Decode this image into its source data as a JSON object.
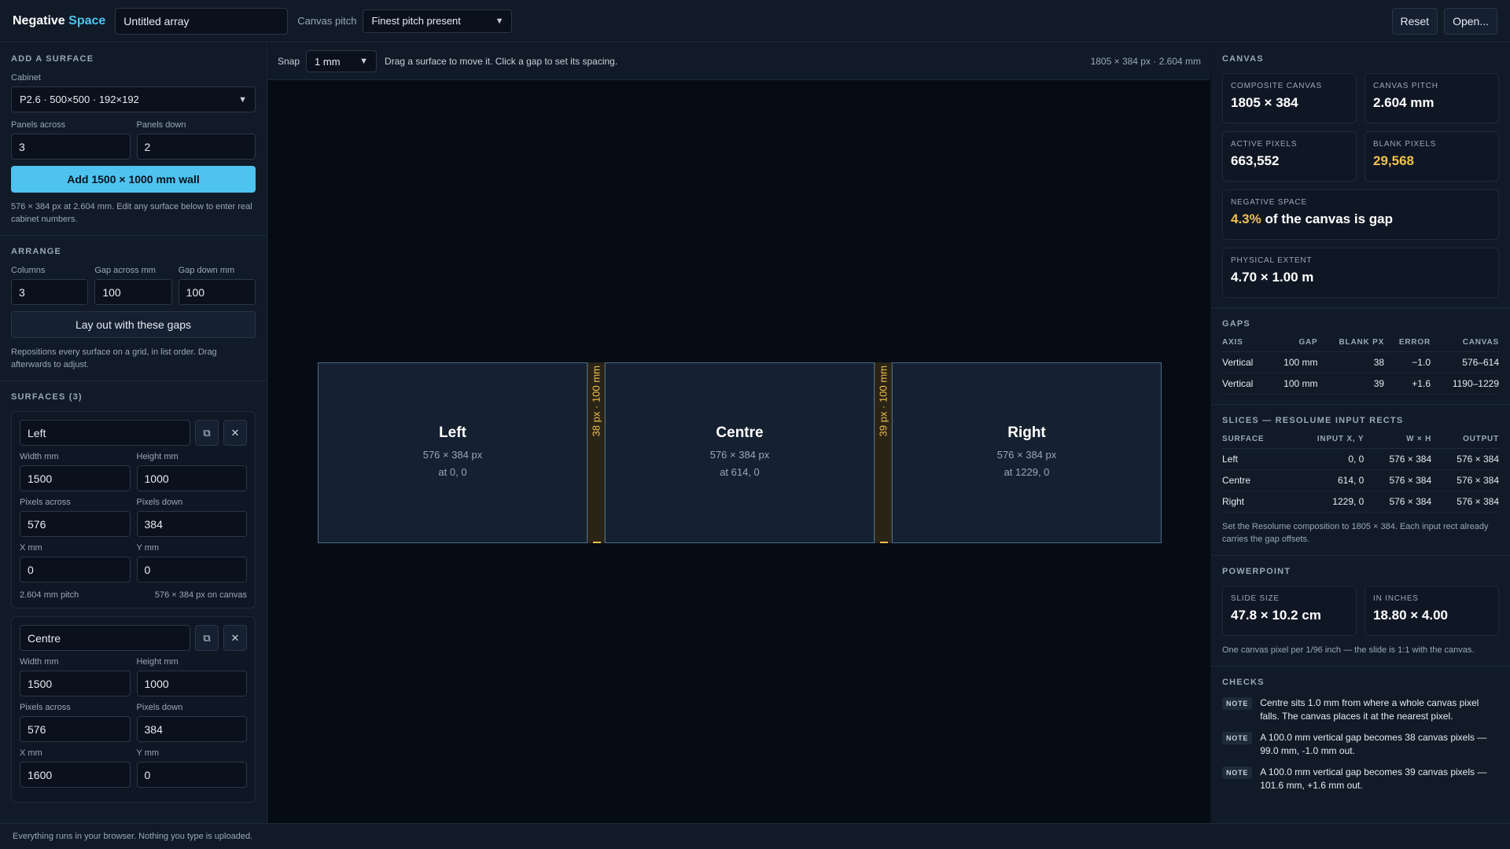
{
  "header": {
    "brand_prefix": "Negative",
    "brand_accent": "Space",
    "title_value": "Untitled array",
    "pitch_label": "Canvas pitch",
    "pitch_value": "Finest pitch present",
    "reset_label": "Reset",
    "open_label": "Open..."
  },
  "add_surface": {
    "title": "ADD A SURFACE",
    "cabinet_label": "Cabinet",
    "cabinet_value": "P2.6 · 500×500 · 192×192",
    "panels_across_label": "Panels across",
    "panels_across_value": "3",
    "panels_down_label": "Panels down",
    "panels_down_value": "2",
    "add_button": "Add 1500 × 1000 mm wall",
    "help": "576 × 384 px at 2.604 mm. Edit any surface below to enter real cabinet numbers."
  },
  "arrange": {
    "title": "ARRANGE",
    "columns_label": "Columns",
    "columns_value": "3",
    "gap_across_label": "Gap across mm",
    "gap_across_value": "100",
    "gap_down_label": "Gap down mm",
    "gap_down_value": "100",
    "layout_button": "Lay out with these gaps",
    "help": "Repositions every surface on a grid, in list order. Drag afterwards to adjust."
  },
  "surfaces_panel": {
    "title": "SURFACES (3)",
    "labels": {
      "width": "Width mm",
      "height": "Height mm",
      "px_across": "Pixels across",
      "px_down": "Pixels down",
      "x": "X mm",
      "y": "Y mm"
    },
    "cards": [
      {
        "name": "Left",
        "width": "1500",
        "height": "1000",
        "px_across": "576",
        "px_down": "384",
        "x": "0",
        "y": "0",
        "pitch_note": "2.604 mm pitch",
        "canvas_note": "576 × 384 px on canvas"
      },
      {
        "name": "Centre",
        "width": "1500",
        "height": "1000",
        "px_across": "576",
        "px_down": "384",
        "x": "1600",
        "y": "0"
      }
    ]
  },
  "toolbar": {
    "snap_label": "Snap",
    "snap_value": "1 mm",
    "hint": "Drag a surface to move it. Click a gap to set its spacing.",
    "meta": "1805 × 384 px · 2.604 mm"
  },
  "canvas": {
    "surfaces": [
      {
        "name": "Left",
        "size": "576 × 384 px",
        "position": "at 0, 0"
      },
      {
        "name": "Centre",
        "size": "576 × 384 px",
        "position": "at 614, 0"
      },
      {
        "name": "Right",
        "size": "576 × 384 px",
        "position": "at 1229, 0"
      }
    ],
    "gaps": [
      {
        "label": "38 px · 100 mm"
      },
      {
        "label": "39 px · 100 mm"
      }
    ]
  },
  "stats": {
    "title": "CANVAS",
    "composite_label": "COMPOSITE CANVAS",
    "composite_value": "1805 × 384",
    "pitch_label": "CANVAS PITCH",
    "pitch_value": "2.604 mm",
    "active_label": "ACTIVE PIXELS",
    "active_value": "663,552",
    "blank_label": "BLANK PIXELS",
    "blank_value": "29,568",
    "negative_label": "NEGATIVE SPACE",
    "negative_pct": "4.3%",
    "negative_text": "of the canvas is gap",
    "extent_label": "PHYSICAL EXTENT",
    "extent_value": "4.70 × 1.00 m"
  },
  "gaps_table": {
    "title": "GAPS",
    "headers": [
      "AXIS",
      "GAP",
      "BLANK PX",
      "ERROR",
      "CANVAS"
    ],
    "rows": [
      [
        "Vertical",
        "100 mm",
        "38",
        "−1.0",
        "576–614"
      ],
      [
        "Vertical",
        "100 mm",
        "39",
        "+1.6",
        "1190–1229"
      ]
    ]
  },
  "slices": {
    "title": "SLICES — RESOLUME INPUT RECTS",
    "headers": [
      "SURFACE",
      "INPUT X, Y",
      "W × H",
      "OUTPUT"
    ],
    "rows": [
      [
        "Left",
        "0, 0",
        "576 × 384",
        "576 × 384"
      ],
      [
        "Centre",
        "614, 0",
        "576 × 384",
        "576 × 384"
      ],
      [
        "Right",
        "1229, 0",
        "576 × 384",
        "576 × 384"
      ]
    ],
    "help": "Set the Resolume composition to 1805 × 384. Each input rect already carries the gap offsets."
  },
  "powerpoint": {
    "title": "POWERPOINT",
    "slide_label": "SLIDE SIZE",
    "slide_value": "47.8 × 10.2 cm",
    "inches_label": "IN INCHES",
    "inches_value": "18.80 × 4.00",
    "help": "One canvas pixel per 1/96 inch — the slide is 1:1 with the canvas."
  },
  "checks": {
    "title": "CHECKS",
    "badge": "NOTE",
    "notes": [
      "Centre sits 1.0 mm from where a whole canvas pixel falls. The canvas places it at the nearest pixel.",
      "A 100.0 mm vertical gap becomes 38 canvas pixels — 99.0 mm, -1.0 mm out.",
      "A 100.0 mm vertical gap becomes 39 canvas pixels — 101.6 mm, +1.6 mm out."
    ]
  },
  "footer": {
    "text": "Everything runs in your browser. Nothing you type is uploaded."
  },
  "icons": {
    "duplicate": "duplicate-icon",
    "close": "close-icon",
    "dropdown": "chevron-down-icon"
  },
  "colors": {
    "accent": "#4ec3f0",
    "warning": "#f2c14e",
    "background": "#060c14",
    "panel": "#111a27"
  }
}
